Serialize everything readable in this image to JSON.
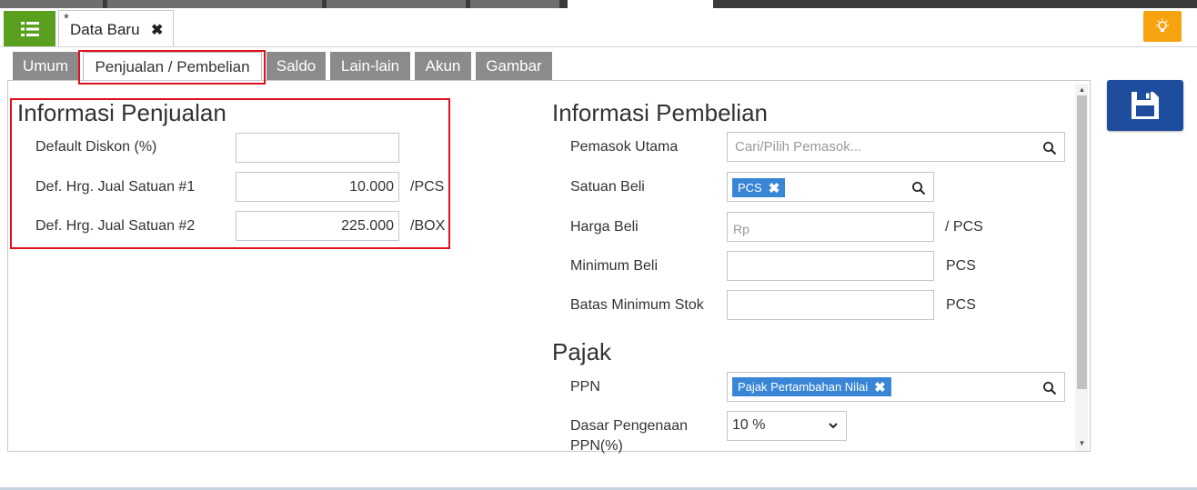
{
  "header": {
    "menu_icon": "list-icon",
    "doc_tab": {
      "modified_marker": "*",
      "title": "Data Baru",
      "close": "✖"
    },
    "hint_icon": "lightbulb-icon"
  },
  "tabs": [
    {
      "label": "Umum",
      "active": false
    },
    {
      "label": "Penjualan / Pembelian",
      "active": true
    },
    {
      "label": "Saldo",
      "active": false
    },
    {
      "label": "Lain-lain",
      "active": false
    },
    {
      "label": "Akun",
      "active": false
    },
    {
      "label": "Gambar",
      "active": false
    }
  ],
  "sales": {
    "title": "Informasi Penjualan",
    "default_discount": {
      "label": "Default Diskon (%)",
      "value": ""
    },
    "price_unit_1": {
      "label": "Def. Hrg. Jual Satuan #1",
      "value": "10.000",
      "unit": "/PCS"
    },
    "price_unit_2": {
      "label": "Def. Hrg. Jual Satuan #2",
      "value": "225.000",
      "unit": "/BOX"
    }
  },
  "purchase": {
    "title": "Informasi Pembelian",
    "main_supplier": {
      "label": "Pemasok Utama",
      "placeholder": "Cari/Pilih Pemasok..."
    },
    "purchase_unit": {
      "label": "Satuan Beli",
      "chip": "PCS"
    },
    "purchase_price": {
      "label": "Harga Beli",
      "placeholder": "Rp",
      "unit": "/ PCS"
    },
    "minimum_purchase": {
      "label": "Minimum Beli",
      "value": "",
      "unit": "PCS"
    },
    "minimum_stock": {
      "label": "Batas Minimum Stok",
      "value": "",
      "unit": "PCS"
    }
  },
  "tax": {
    "title": "Pajak",
    "ppn": {
      "label": "PPN",
      "chip": "Pajak Pertambahan Nilai"
    },
    "ppn_base": {
      "label_line1": "Dasar Pengenaan",
      "label_line2": "PPN(%)",
      "selected": "10 %"
    }
  },
  "colors": {
    "menu_green": "#5aa01f",
    "hint_orange": "#f7a310",
    "save_blue": "#1e4d9e",
    "chip_blue": "#3a86d6",
    "highlight_red": "#e0101d",
    "tab_gray": "#8b8b8b"
  }
}
